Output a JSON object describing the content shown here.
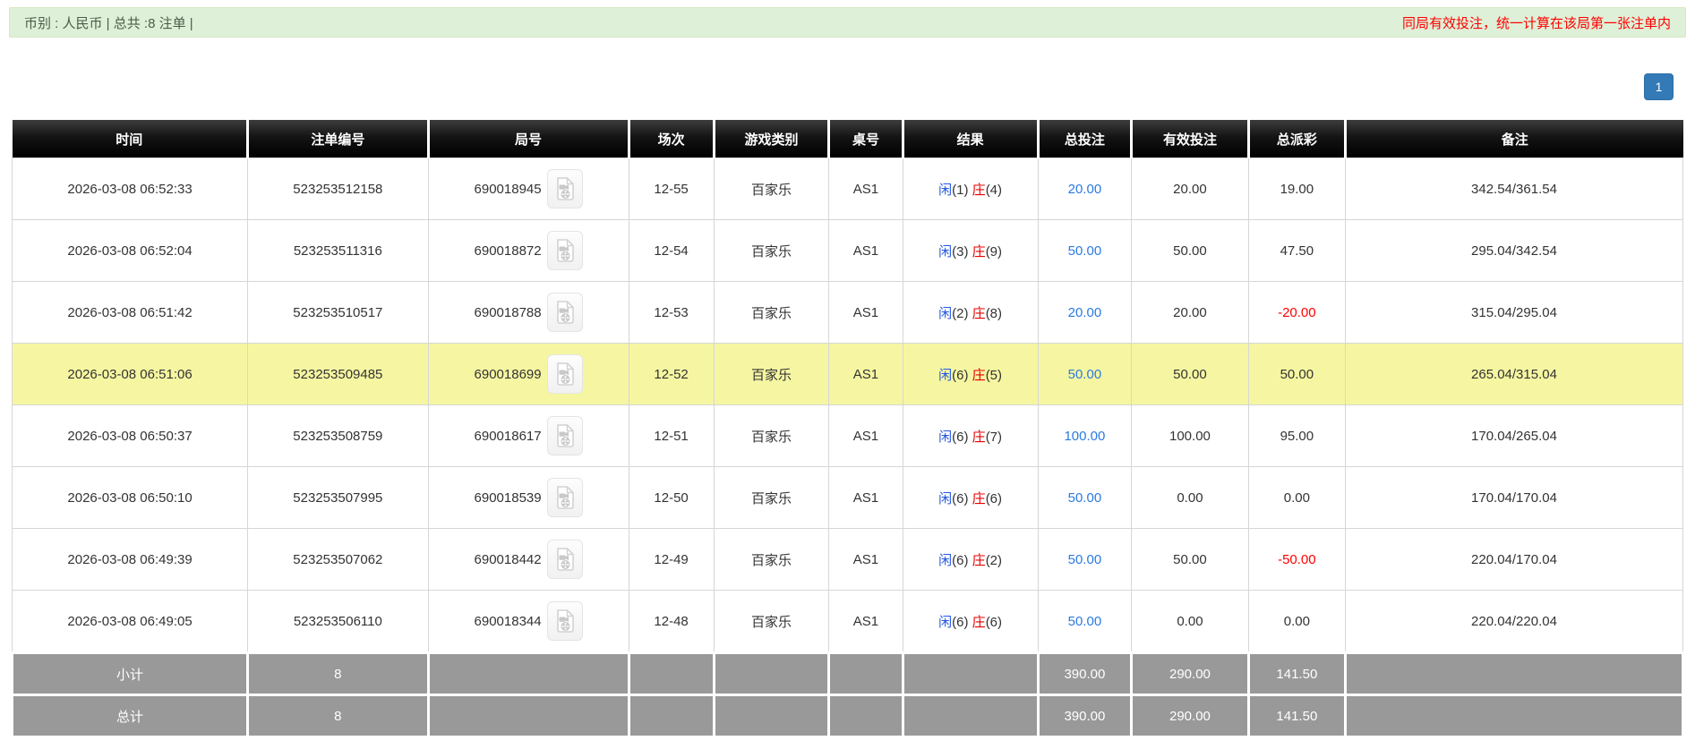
{
  "topbar": {
    "summary_text": "币别 : 人民币 | 总共 :8 注单 |",
    "notice_text": "同局有效投注，统一计算在该局第一张注单内"
  },
  "pagination": {
    "current_page": "1"
  },
  "table": {
    "headers": [
      "时间",
      "注单编号",
      "局号",
      "场次",
      "游戏类别",
      "桌号",
      "结果",
      "总投注",
      "有效投注",
      "总派彩",
      "备注"
    ],
    "rows": [
      {
        "time": "2026-03-08 06:52:33",
        "bet_id": "523253512158",
        "round_id": "690018945",
        "session": "12-55",
        "game_type": "百家乐",
        "table_no": "AS1",
        "player_label": "闲",
        "player_score": "(1)",
        "banker_label": "庄",
        "banker_score": "(4)",
        "total_bet": "20.00",
        "valid_bet": "20.00",
        "payout": "19.00",
        "remark": "342.54/361.54",
        "highlighted": false
      },
      {
        "time": "2026-03-08 06:52:04",
        "bet_id": "523253511316",
        "round_id": "690018872",
        "session": "12-54",
        "game_type": "百家乐",
        "table_no": "AS1",
        "player_label": "闲",
        "player_score": "(3)",
        "banker_label": "庄",
        "banker_score": "(9)",
        "total_bet": "50.00",
        "valid_bet": "50.00",
        "payout": "47.50",
        "remark": "295.04/342.54",
        "highlighted": false
      },
      {
        "time": "2026-03-08 06:51:42",
        "bet_id": "523253510517",
        "round_id": "690018788",
        "session": "12-53",
        "game_type": "百家乐",
        "table_no": "AS1",
        "player_label": "闲",
        "player_score": "(2)",
        "banker_label": "庄",
        "banker_score": "(8)",
        "total_bet": "20.00",
        "valid_bet": "20.00",
        "payout": "-20.00",
        "remark": "315.04/295.04",
        "highlighted": false
      },
      {
        "time": "2026-03-08 06:51:06",
        "bet_id": "523253509485",
        "round_id": "690018699",
        "session": "12-52",
        "game_type": "百家乐",
        "table_no": "AS1",
        "player_label": "闲",
        "player_score": "(6)",
        "banker_label": "庄",
        "banker_score": "(5)",
        "total_bet": "50.00",
        "valid_bet": "50.00",
        "payout": "50.00",
        "remark": "265.04/315.04",
        "highlighted": true
      },
      {
        "time": "2026-03-08 06:50:37",
        "bet_id": "523253508759",
        "round_id": "690018617",
        "session": "12-51",
        "game_type": "百家乐",
        "table_no": "AS1",
        "player_label": "闲",
        "player_score": "(6)",
        "banker_label": "庄",
        "banker_score": "(7)",
        "total_bet": "100.00",
        "valid_bet": "100.00",
        "payout": "95.00",
        "remark": "170.04/265.04",
        "highlighted": false
      },
      {
        "time": "2026-03-08 06:50:10",
        "bet_id": "523253507995",
        "round_id": "690018539",
        "session": "12-50",
        "game_type": "百家乐",
        "table_no": "AS1",
        "player_label": "闲",
        "player_score": "(6)",
        "banker_label": "庄",
        "banker_score": "(6)",
        "total_bet": "50.00",
        "valid_bet": "0.00",
        "payout": "0.00",
        "remark": "170.04/170.04",
        "highlighted": false
      },
      {
        "time": "2026-03-08 06:49:39",
        "bet_id": "523253507062",
        "round_id": "690018442",
        "session": "12-49",
        "game_type": "百家乐",
        "table_no": "AS1",
        "player_label": "闲",
        "player_score": "(6)",
        "banker_label": "庄",
        "banker_score": "(2)",
        "total_bet": "50.00",
        "valid_bet": "50.00",
        "payout": "-50.00",
        "remark": "220.04/170.04",
        "highlighted": false
      },
      {
        "time": "2026-03-08 06:49:05",
        "bet_id": "523253506110",
        "round_id": "690018344",
        "session": "12-48",
        "game_type": "百家乐",
        "table_no": "AS1",
        "player_label": "闲",
        "player_score": "(6)",
        "banker_label": "庄",
        "banker_score": "(6)",
        "total_bet": "50.00",
        "valid_bet": "0.00",
        "payout": "0.00",
        "remark": "220.04/220.04",
        "highlighted": false
      }
    ],
    "subtotal": {
      "label": "小计",
      "count": "8",
      "total_bet": "390.00",
      "valid_bet": "290.00",
      "payout": "141.50"
    },
    "total": {
      "label": "总计",
      "count": "8",
      "total_bet": "390.00",
      "valid_bet": "290.00",
      "payout": "141.50"
    }
  },
  "colors": {
    "topbar_bg": "#dff0d8",
    "notice_red": "#ff0000",
    "pager_blue": "#337ab7",
    "header_bg": "#000000",
    "highlight_yellow": "#f6f6a2",
    "footer_gray": "#999999",
    "player_blue": "#2457e0",
    "banker_red": "#e60000",
    "link_blue": "#2a7ae2",
    "negative_red": "#ff0000"
  }
}
